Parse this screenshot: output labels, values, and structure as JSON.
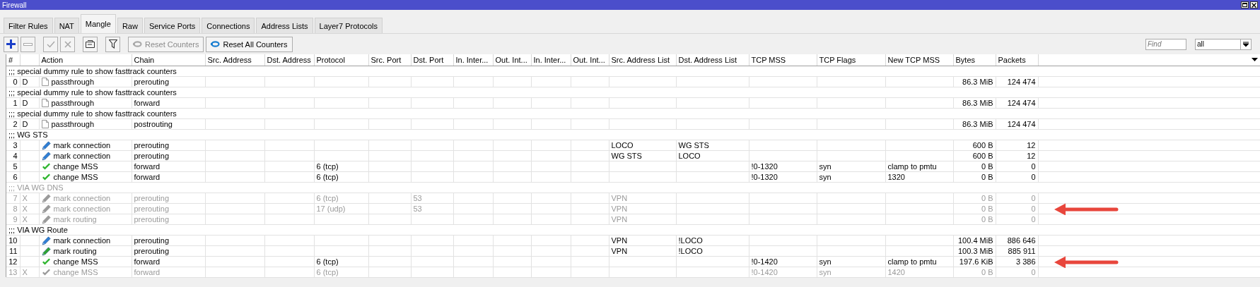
{
  "window": {
    "title": "Firewall"
  },
  "tabs": [
    {
      "label": "Filter Rules",
      "selected": false
    },
    {
      "label": "NAT",
      "selected": false
    },
    {
      "label": "Mangle",
      "selected": true
    },
    {
      "label": "Raw",
      "selected": false
    },
    {
      "label": "Service Ports",
      "selected": false
    },
    {
      "label": "Connections",
      "selected": false
    },
    {
      "label": "Address Lists",
      "selected": false
    },
    {
      "label": "Layer7 Protocols",
      "selected": false
    }
  ],
  "toolbar": {
    "buttons": [
      {
        "kind": "add",
        "disabled": false
      },
      {
        "kind": "remove",
        "disabled": true
      },
      {
        "kind": "enable",
        "disabled": true
      },
      {
        "kind": "disable",
        "disabled": true
      },
      {
        "kind": "comment",
        "disabled": false
      },
      {
        "kind": "filter",
        "disabled": false
      }
    ],
    "reset_buttons": [
      {
        "label": "Reset Counters",
        "disabled": true
      },
      {
        "label": "Reset All Counters",
        "disabled": false
      }
    ],
    "search": {
      "placeholder": "Find"
    },
    "filter_select": {
      "value": "all"
    }
  },
  "table": {
    "columns": [
      "#",
      "Action",
      "Chain",
      "Src. Address",
      "Dst. Address",
      "Protocol",
      "Src. Port",
      "Dst. Port",
      "In. Inter...",
      "Out. Int...",
      "In. Inter...",
      "Out. Int...",
      "Src. Address List",
      "Dst. Address List",
      "TCP MSS",
      "TCP Flags",
      "New TCP MSS",
      "Bytes",
      "Packets"
    ],
    "rows": [
      {
        "kind": "comment",
        "text": ";;; special dummy rule to show fasttrack counters",
        "disabled": false
      },
      {
        "kind": "passthrough",
        "number": "0",
        "flag": "D",
        "action": "passthrough",
        "chain": "prerouting",
        "bytes": "86.3 MiB",
        "packets": "124 474",
        "disabled": false,
        "marked": false
      },
      {
        "kind": "comment",
        "text": ";;; special dummy rule to show fasttrack counters",
        "disabled": false
      },
      {
        "kind": "passthrough",
        "number": "1",
        "flag": "D",
        "action": "passthrough",
        "chain": "forward",
        "bytes": "86.3 MiB",
        "packets": "124 474",
        "disabled": false,
        "marked": false
      },
      {
        "kind": "comment",
        "text": ";;; special dummy rule to show fasttrack counters",
        "disabled": false
      },
      {
        "kind": "passthrough",
        "number": "2",
        "flag": "D",
        "action": "passthrough",
        "chain": "postrouting",
        "bytes": "86.3 MiB",
        "packets": "124 474",
        "disabled": false,
        "marked": false
      },
      {
        "kind": "comment",
        "text": ";;; WG STS",
        "disabled": false
      },
      {
        "kind": "markconnection",
        "number": "3",
        "action": "mark connection",
        "chain": "prerouting",
        "src_address_list": "LOCO",
        "dst_address_list": "WG STS",
        "bytes": "600 B",
        "packets": "12",
        "disabled": false,
        "marked": false
      },
      {
        "kind": "markconnection",
        "number": "4",
        "action": "mark connection",
        "chain": "prerouting",
        "src_address_list": "WG STS",
        "dst_address_list": "LOCO",
        "bytes": "600 B",
        "packets": "12",
        "disabled": false,
        "marked": false
      },
      {
        "kind": "changemss",
        "number": "5",
        "action": "change MSS",
        "chain": "forward",
        "protocol": "6 (tcp)",
        "tcp_mss": "!0-1320",
        "tcp_flags": "syn",
        "new_tcp_mss": "clamp to pmtu",
        "bytes": "0 B",
        "packets": "0",
        "disabled": false,
        "marked": false
      },
      {
        "kind": "changemss",
        "number": "6",
        "action": "change MSS",
        "chain": "forward",
        "protocol": "6 (tcp)",
        "tcp_mss": "!0-1320",
        "tcp_flags": "syn",
        "new_tcp_mss": "1320",
        "bytes": "0 B",
        "packets": "0",
        "disabled": false,
        "marked": false
      },
      {
        "kind": "comment",
        "text": ";;; VIA WG DNS",
        "disabled": true
      },
      {
        "kind": "markconnection",
        "number": "7",
        "flag": "X",
        "action": "mark connection",
        "chain": "prerouting",
        "protocol": "6 (tcp)",
        "dst_port": "53",
        "src_address_list": "VPN",
        "bytes": "0 B",
        "packets": "0",
        "disabled": true,
        "marked": false
      },
      {
        "kind": "markconnection",
        "number": "8",
        "flag": "X",
        "action": "mark connection",
        "chain": "prerouting",
        "protocol": "17 (udp)",
        "dst_port": "53",
        "src_address_list": "VPN",
        "bytes": "0 B",
        "packets": "0",
        "disabled": true,
        "marked": true
      },
      {
        "kind": "markrouting",
        "number": "9",
        "flag": "X",
        "action": "mark routing",
        "chain": "prerouting",
        "src_address_list": "VPN",
        "bytes": "0 B",
        "packets": "0",
        "disabled": true,
        "marked": false
      },
      {
        "kind": "comment",
        "text": ";;; VIA WG Route",
        "disabled": false
      },
      {
        "kind": "markconnection",
        "number": "10",
        "action": "mark connection",
        "chain": "prerouting",
        "src_address_list": "VPN",
        "dst_address_list": "!LOCO",
        "bytes": "100.4 MiB",
        "packets": "886 646",
        "disabled": false,
        "marked": false
      },
      {
        "kind": "markrouting",
        "number": "11",
        "action": "mark routing",
        "chain": "prerouting",
        "src_address_list": "VPN",
        "dst_address_list": "!LOCO",
        "bytes": "100.3 MiB",
        "packets": "885 911",
        "disabled": false,
        "marked": false
      },
      {
        "kind": "changemss",
        "number": "12",
        "action": "change MSS",
        "chain": "forward",
        "protocol": "6 (tcp)",
        "tcp_mss": "!0-1420",
        "tcp_flags": "syn",
        "new_tcp_mss": "clamp to pmtu",
        "bytes": "197.6 KiB",
        "packets": "3 386",
        "disabled": false,
        "marked": true
      },
      {
        "kind": "changemss",
        "number": "13",
        "flag": "X",
        "action": "change MSS",
        "chain": "forward",
        "protocol": "6 (tcp)",
        "tcp_mss": "!0-1420",
        "tcp_flags": "syn",
        "new_tcp_mss": "1420",
        "bytes": "0 B",
        "packets": "0",
        "disabled": true,
        "marked": false
      }
    ]
  }
}
